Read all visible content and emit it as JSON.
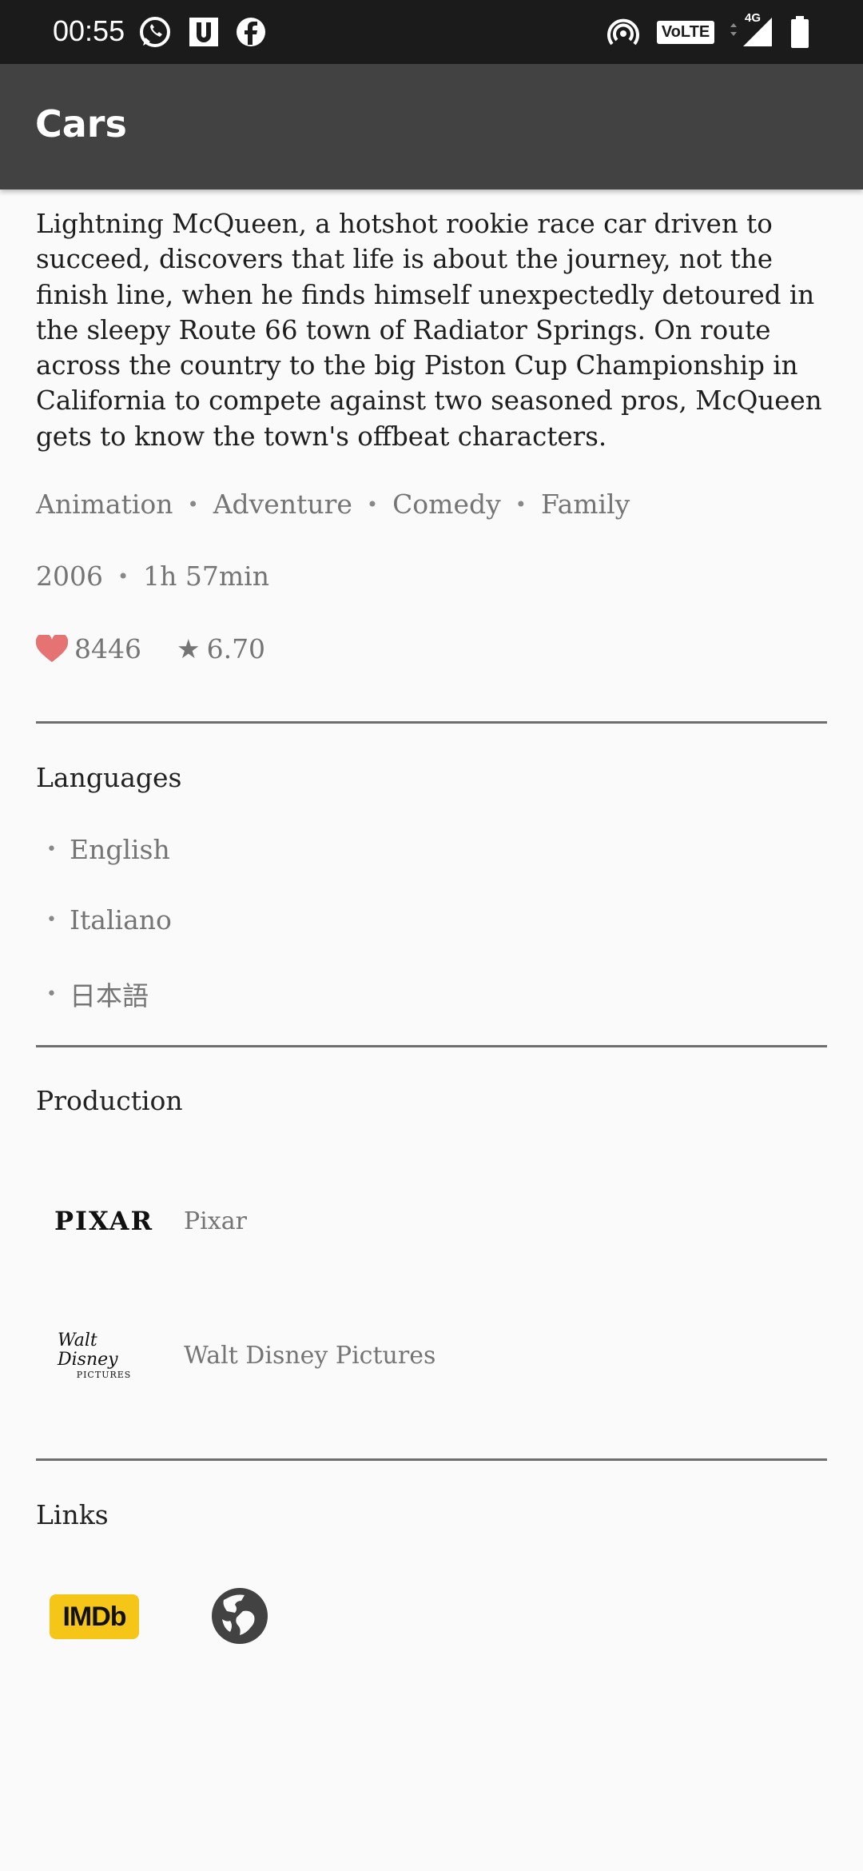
{
  "status_bar": {
    "time": "00:55",
    "left_icons": [
      "whatsapp-icon",
      "u-app-icon",
      "facebook-icon"
    ],
    "right_icons": [
      "hotspot-icon",
      "volte-icon",
      "signal-4g-icon",
      "battery-icon"
    ],
    "volte_label": "VoLTE",
    "network_label": "4G"
  },
  "app_bar": {
    "title": "Cars"
  },
  "movie": {
    "overview": "Lightning McQueen, a hotshot rookie race car driven to succeed, discovers that life is about the journey, not the finish line, when he finds himself unexpectedly detoured in the sleepy Route 66 town of Radiator Springs. On route across the country to the big Piston Cup Championship in California to compete against two seasoned pros, McQueen gets to know the town's offbeat characters.",
    "genres": [
      "Animation",
      "Adventure",
      "Comedy",
      "Family"
    ],
    "year": "2006",
    "runtime": "1h 57min",
    "likes": "8446",
    "rating": "6.70"
  },
  "languages": {
    "title": "Languages",
    "items": [
      "English",
      "Italiano",
      "日本語"
    ]
  },
  "production": {
    "title": "Production",
    "companies": [
      {
        "logo_text": "PIXAR",
        "name": "Pixar"
      },
      {
        "logo_text": "Walt Disney",
        "logo_subtext": "PICTURES",
        "name": "Walt Disney Pictures"
      }
    ]
  },
  "links": {
    "title": "Links",
    "imdb_label": "IMDb",
    "website_icon": "globe-icon"
  },
  "colors": {
    "status_bar": "#1b1b1b",
    "app_bar": "#424242",
    "background": "#fafafa",
    "secondary_text": "#757575",
    "heart": "#e57373",
    "imdb_yellow": "#f5c518"
  }
}
